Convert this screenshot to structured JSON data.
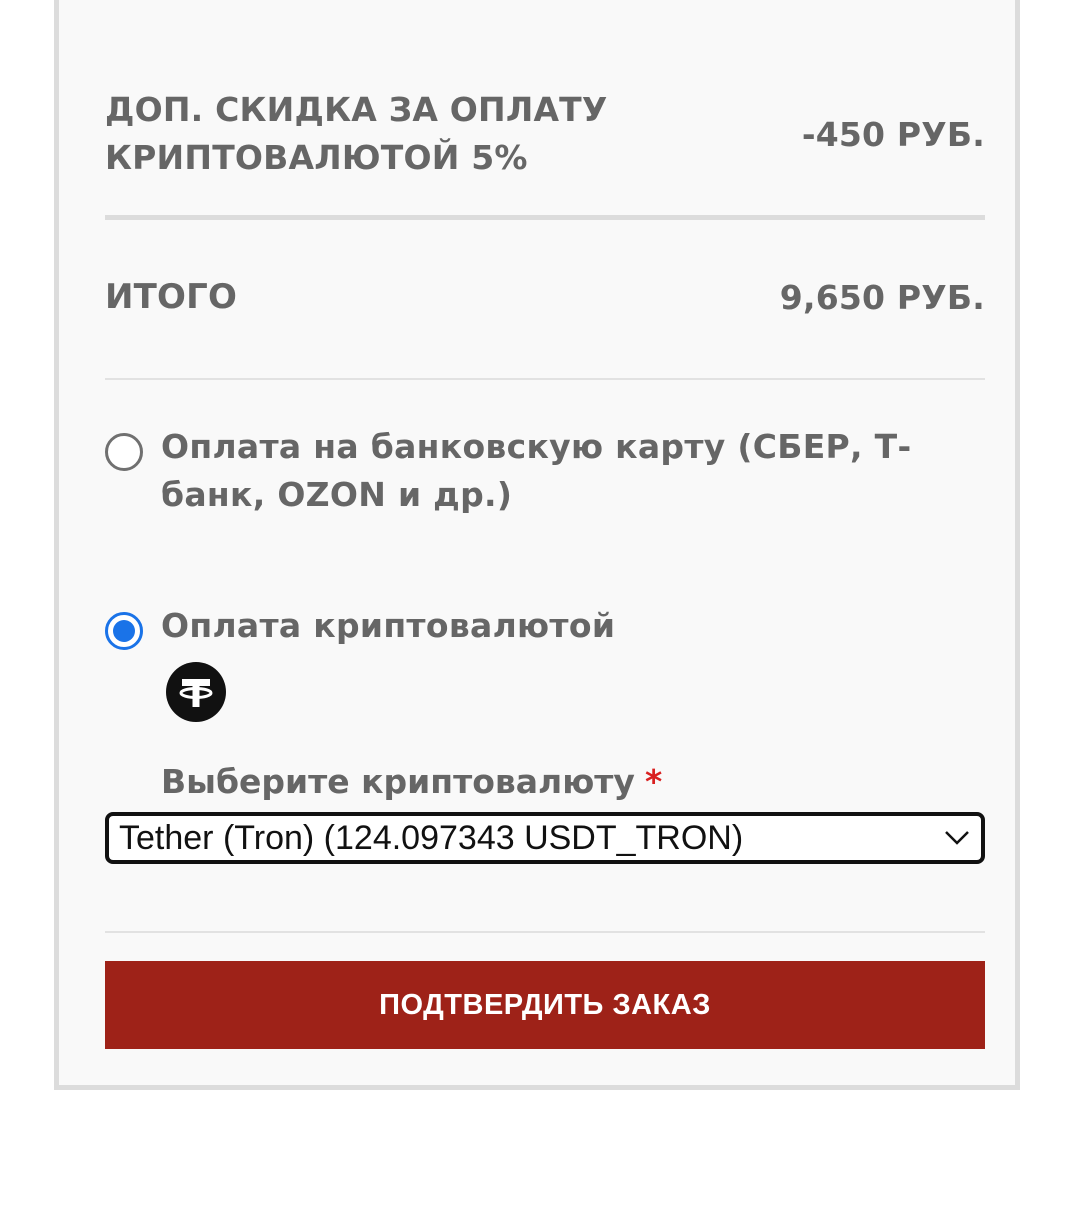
{
  "summary": {
    "discount_label": "ДОП. СКИДКА ЗА ОПЛАТУ КРИПТОВАЛЮТОЙ 5%",
    "discount_value": "-450 РУБ.",
    "total_label": "ИТОГО",
    "total_value": "9,650 РУБ."
  },
  "payment_options": [
    {
      "label": "Оплата на банковскую карту (СБЕР, Т-банк, OZON и др.)",
      "selected": false
    },
    {
      "label": "Оплата криптовалютой",
      "selected": true
    }
  ],
  "crypto": {
    "icon": "tether-icon",
    "select_label": "Выберите криптовалюту",
    "required_mark": "*",
    "selected_value": "Tether (Tron) (124.097343 USDT_TRON)"
  },
  "submit_label": "ПОДТВЕРДИТЬ ЗАКАЗ",
  "colors": {
    "accent_button": "#9e2218",
    "radio_selected": "#1a73e8",
    "required": "#d92020"
  }
}
